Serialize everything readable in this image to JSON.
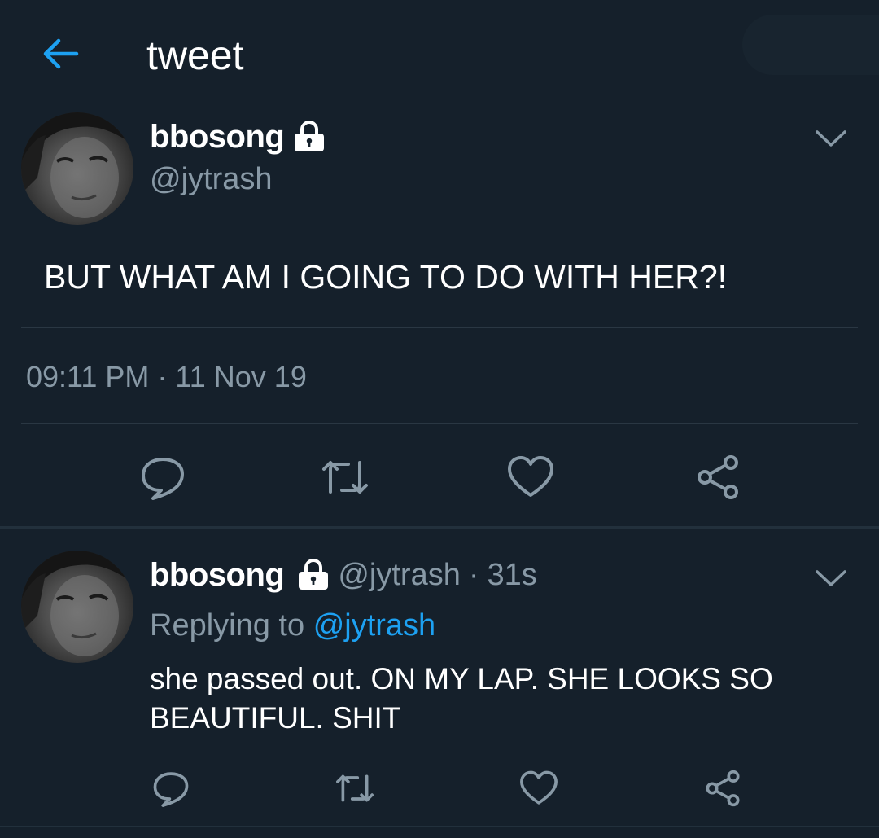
{
  "header": {
    "title": "tweet"
  },
  "main_tweet": {
    "display_name": "bbosong",
    "handle": "@jytrash",
    "text": "BUT WHAT AM I GOING TO DO WITH HER?!",
    "timestamp": "09:11 PM · 11 Nov 19"
  },
  "reply_tweet": {
    "display_name": "bbosong",
    "handle": "@jytrash",
    "separator": "·",
    "time_ago": "31s",
    "replying_prefix": "Replying to",
    "replying_handle": "@jytrash",
    "text": "she passed out. ON MY LAP. SHE LOOKS SO BEAUTIFUL. SHIT"
  },
  "icons": {
    "back": "arrow-left-icon",
    "lock": "lock-icon",
    "more": "chevron-down-icon",
    "reply": "reply-icon",
    "retweet": "retweet-icon",
    "like": "heart-icon",
    "share": "share-icon"
  },
  "colors": {
    "background": "#15202b",
    "accent": "#1da1f2",
    "muted_text": "#8899a6",
    "icon": "#8899a6",
    "divider": "#2a3743"
  }
}
